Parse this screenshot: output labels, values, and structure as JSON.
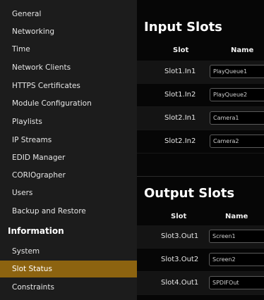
{
  "sidebar": {
    "items": [
      {
        "label": "General"
      },
      {
        "label": "Networking"
      },
      {
        "label": "Time"
      },
      {
        "label": "Network Clients"
      },
      {
        "label": "HTTPS Certificates"
      },
      {
        "label": "Module Configuration"
      },
      {
        "label": "Playlists"
      },
      {
        "label": "IP Streams"
      },
      {
        "label": "EDID Manager"
      },
      {
        "label": "CORIOgrapher"
      },
      {
        "label": "Users"
      },
      {
        "label": "Backup and Restore"
      }
    ],
    "section_label": "Information",
    "info_items": [
      {
        "label": "System"
      },
      {
        "label": "Slot Status",
        "active": true
      },
      {
        "label": "Constraints"
      }
    ]
  },
  "input_slots": {
    "title": "Input Slots",
    "col_slot": "Slot",
    "col_name": "Name",
    "rows": [
      {
        "slot": "Slot1.In1",
        "name": "PlayQueue1"
      },
      {
        "slot": "Slot1.In2",
        "name": "PlayQueue2"
      },
      {
        "slot": "Slot2.In1",
        "name": "Camera1"
      },
      {
        "slot": "Slot2.In2",
        "name": "Camera2"
      }
    ]
  },
  "output_slots": {
    "title": "Output Slots",
    "col_slot": "Slot",
    "col_name": "Name",
    "rows": [
      {
        "slot": "Slot3.Out1",
        "name": "Screen1"
      },
      {
        "slot": "Slot3.Out2",
        "name": "Screen2"
      },
      {
        "slot": "Slot4.Out1",
        "name": "SPDIFOut"
      }
    ]
  },
  "colors": {
    "active_item": "#8c6310",
    "sidebar_bg": "#1c1c1c",
    "main_bg": "#060606"
  }
}
